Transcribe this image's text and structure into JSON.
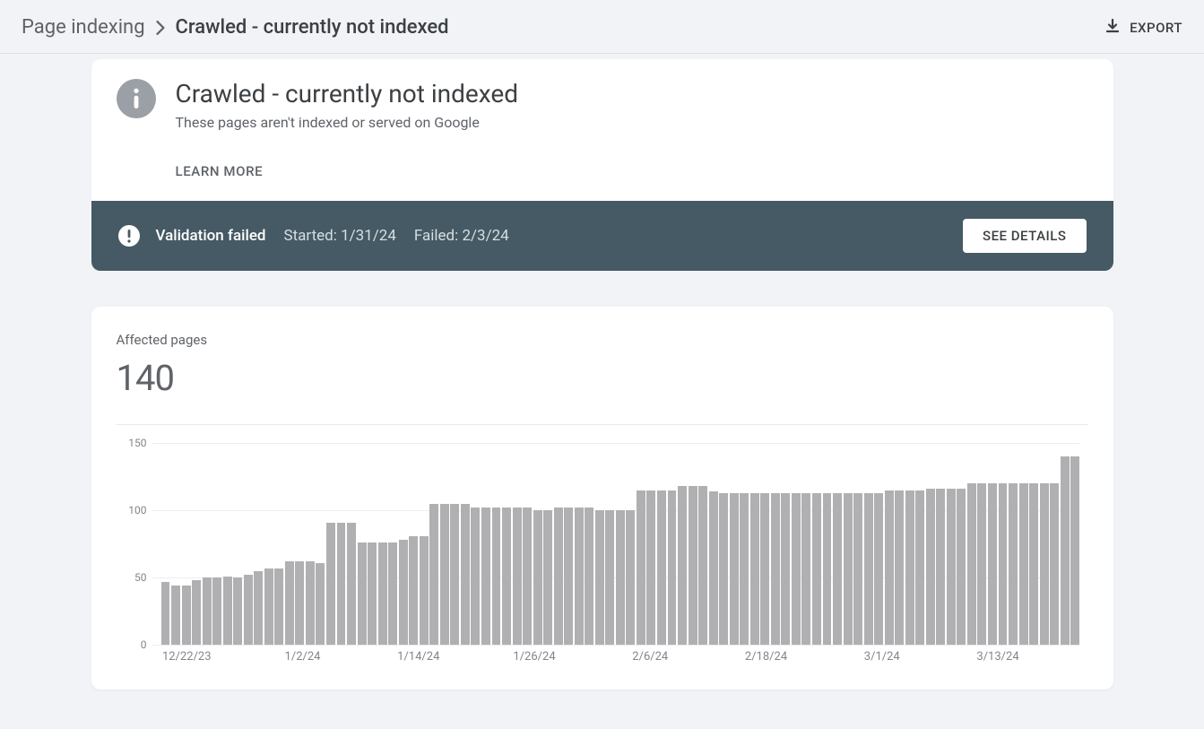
{
  "breadcrumb": {
    "parent": "Page indexing",
    "current": "Crawled - currently not indexed"
  },
  "export_label": "EXPORT",
  "info": {
    "title": "Crawled - currently not indexed",
    "subtitle": "These pages aren't indexed or served on Google",
    "learn_more": "LEARN MORE"
  },
  "validation": {
    "status": "Validation failed",
    "started_text": "Started: 1/31/24",
    "failed_text": "Failed: 2/3/24",
    "see_details": "SEE DETAILS"
  },
  "metric": {
    "label": "Affected pages",
    "value": "140"
  },
  "chart_data": {
    "type": "bar",
    "title": "Affected pages",
    "ylabel": "",
    "xlabel": "",
    "ylim": [
      0,
      150
    ],
    "yticks": [
      0,
      50,
      100,
      150
    ],
    "xticks": [
      "12/22/23",
      "1/2/24",
      "1/14/24",
      "1/26/24",
      "2/6/24",
      "2/18/24",
      "3/1/24",
      "3/13/24"
    ],
    "values": [
      47,
      44,
      44,
      48,
      50,
      50,
      51,
      50,
      52,
      55,
      57,
      57,
      62,
      62,
      62,
      61,
      91,
      91,
      91,
      76,
      76,
      76,
      76,
      78,
      81,
      81,
      105,
      105,
      105,
      105,
      102,
      102,
      102,
      102,
      102,
      102,
      100,
      100,
      102,
      102,
      102,
      102,
      100,
      100,
      100,
      100,
      115,
      115,
      115,
      115,
      118,
      118,
      118,
      114,
      113,
      113,
      113,
      113,
      113,
      113,
      113,
      113,
      113,
      113,
      113,
      113,
      113,
      113,
      113,
      113,
      115,
      115,
      115,
      115,
      116,
      116,
      116,
      116,
      120,
      120,
      120,
      120,
      120,
      120,
      120,
      120,
      120,
      140,
      140
    ]
  }
}
